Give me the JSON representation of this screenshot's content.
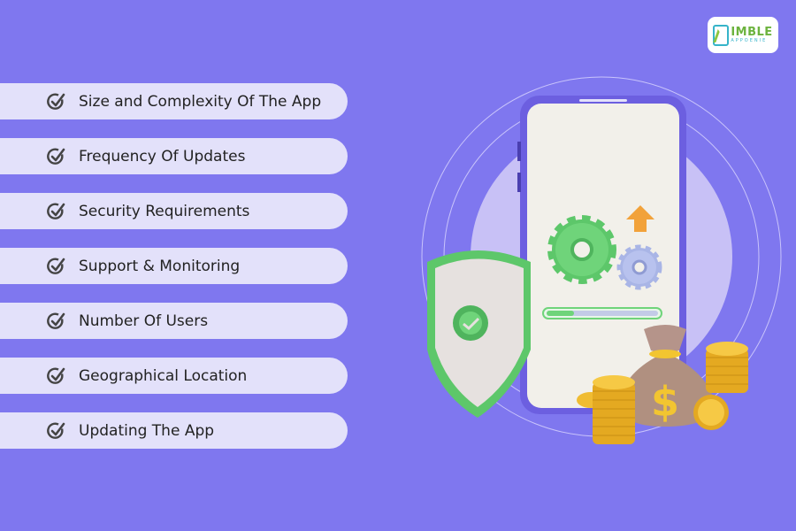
{
  "brand": {
    "name_line1": "IMBLE",
    "name_line2": "APPOENIE",
    "logo_icon": "phone-n-logo-icon",
    "colors": {
      "primary_green": "#6cb33e",
      "accent_teal": "#36b4c9"
    }
  },
  "background_color": "#7f77ef",
  "factors": {
    "icon": "check-circle-icon",
    "items": [
      {
        "label": "Size and Complexity Of The App"
      },
      {
        "label": "Frequency Of Updates"
      },
      {
        "label": "Security Requirements"
      },
      {
        "label": "Support & Monitoring"
      },
      {
        "label": "Number Of Users"
      },
      {
        "label": "Geographical Location"
      },
      {
        "label": "Updating The App"
      }
    ]
  },
  "illustration": {
    "elements": [
      "smartphone",
      "shield-check-icon",
      "gear-icons",
      "upload-arrow-icon",
      "progress-bar",
      "money-bag-icon",
      "coin-stack-icons"
    ],
    "progress_fraction": 0.25,
    "currency_symbol": "$"
  }
}
